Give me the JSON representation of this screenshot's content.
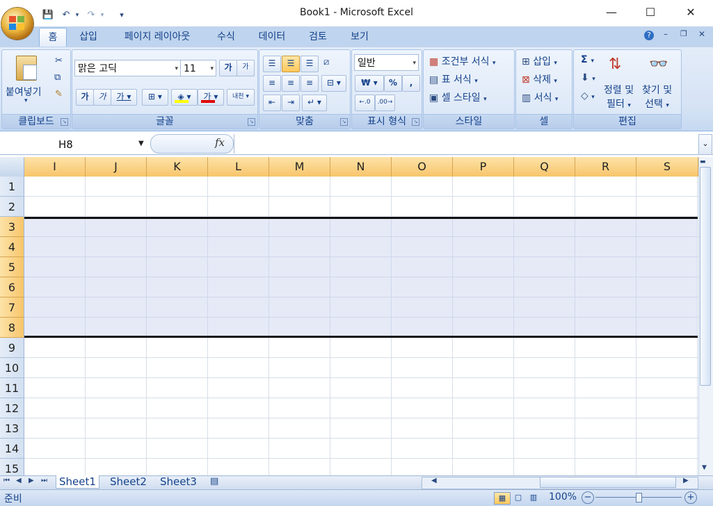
{
  "window": {
    "title": "Book1 - Microsoft Excel",
    "minimize": "—",
    "maximize": "☐",
    "close": "✕"
  },
  "qat": {
    "save": "💾",
    "undo": "↶",
    "redo": "↷",
    "customize": "▾"
  },
  "tabs": [
    "홈",
    "삽입",
    "페이지 레이아웃",
    "수식",
    "데이터",
    "검토",
    "보기"
  ],
  "ribbon": {
    "clipboard": {
      "label": "클립보드",
      "paste": "붙여넣기"
    },
    "font": {
      "label": "글꼴",
      "name": "맑은 고딕",
      "size": "11",
      "grow": "가",
      "shrink": "가",
      "bold": "가",
      "italic": "가",
      "underline": "가",
      "color_letter": "가",
      "phonetic": "내천"
    },
    "alignment": {
      "label": "맞춤"
    },
    "number": {
      "label": "표시 형식",
      "format": "일반",
      "currency": "₩",
      "percent": "%",
      "comma": ","
    },
    "styles": {
      "label": "스타일",
      "conditional": "조건부 서식",
      "table": "표 서식",
      "cell": "셀 스타일"
    },
    "cells": {
      "label": "셀",
      "insert": "삽입",
      "delete": "삭제",
      "format": "서식"
    },
    "editing": {
      "label": "편집",
      "sum": "Σ",
      "sort_line1": "정렬 및",
      "sort_line2": "필터",
      "find_line1": "찾기 및",
      "find_line2": "선택"
    }
  },
  "formula_bar": {
    "name_box": "H8",
    "fx": "fx",
    "value": ""
  },
  "grid": {
    "columns": [
      "I",
      "J",
      "K",
      "L",
      "M",
      "N",
      "O",
      "P",
      "Q",
      "R",
      "S"
    ],
    "rows": [
      "1",
      "2",
      "3",
      "4",
      "5",
      "6",
      "7",
      "8",
      "9",
      "10",
      "11",
      "12",
      "13",
      "14",
      "15"
    ],
    "selected_rows": [
      "3",
      "4",
      "5",
      "6",
      "7",
      "8"
    ]
  },
  "sheets": [
    "Sheet1",
    "Sheet2",
    "Sheet3"
  ],
  "active_sheet": "Sheet1",
  "status": {
    "mode": "준비",
    "zoom": "100%"
  }
}
